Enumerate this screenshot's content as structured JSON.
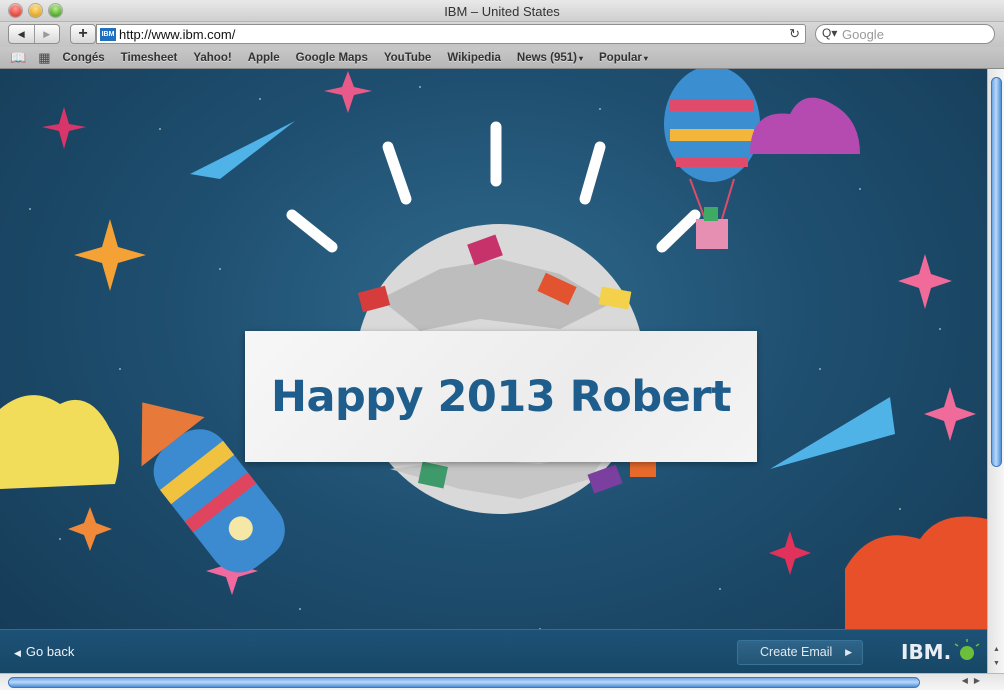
{
  "window": {
    "title": "IBM – United States"
  },
  "toolbar": {
    "back_glyph": "◀",
    "forward_glyph": "▶",
    "add_glyph": "+",
    "favicon_text": "IBM",
    "url": "http://www.ibm.com/",
    "reload_glyph": "↻",
    "search_glyph": "Q▾",
    "search_placeholder": "Google"
  },
  "bookmarks": {
    "reader_glyph": "📖",
    "grid_glyph": "▦",
    "items": [
      {
        "label": "Congés"
      },
      {
        "label": "Timesheet"
      },
      {
        "label": "Yahoo!"
      },
      {
        "label": "Apple"
      },
      {
        "label": "Google Maps"
      },
      {
        "label": "YouTube"
      },
      {
        "label": "Wikipedia"
      },
      {
        "label": "News (951)",
        "menu": "▾"
      },
      {
        "label": "Popular",
        "menu": "▾"
      }
    ]
  },
  "page": {
    "greeting": "Happy 2013 Robert",
    "footer": {
      "go_back": "Go back",
      "go_back_glyph": "◀",
      "create_email": "Create Email",
      "create_email_glyph": "▶",
      "logo_text": "IBM."
    }
  },
  "scrollbar": {
    "up_glyph": "▲",
    "down_glyph": "▼",
    "left_glyph": "◀",
    "right_glyph": "▶"
  },
  "colors": {
    "sky": "#1f4f70",
    "greeting_text": "#1e5d8c",
    "footer": "#1d5277",
    "scroll_thumb": "#6fa6e4"
  }
}
